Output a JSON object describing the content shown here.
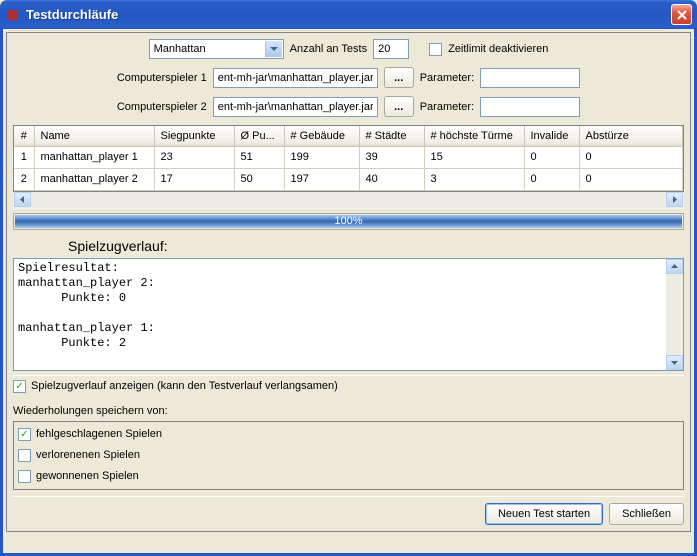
{
  "window": {
    "title": "Testdurchläufe"
  },
  "config": {
    "game": "Manhattan",
    "tests_label": "Anzahl an Tests",
    "tests_value": "20",
    "disable_timelimit_label": "Zeitlimit deaktivieren",
    "player1_label": "Computerspieler 1",
    "player2_label": "Computerspieler 2",
    "player1_path": "ent-mh-jar\\manhattan_player.jar",
    "player2_path": "ent-mh-jar\\manhattan_player.jar",
    "browse_label": "...",
    "param_label": "Parameter:",
    "param1_value": "",
    "param2_value": ""
  },
  "table": {
    "headers": [
      "#",
      "Name",
      "Siegpunkte",
      "Ø Pu...",
      "# Gebäude",
      "# Städte",
      "# höchste Türme",
      "Invalide",
      "Abstürze"
    ],
    "rows": [
      [
        "1",
        "manhattan_player 1",
        "23",
        "51",
        "199",
        "39",
        "15",
        "0",
        "0"
      ],
      [
        "2",
        "manhattan_player 2",
        "17",
        "50",
        "197",
        "40",
        "3",
        "0",
        "0"
      ]
    ]
  },
  "progress": {
    "text": "100%"
  },
  "log": {
    "heading": "Spielzugverlauf:",
    "lines": [
      "Spielresultat:",
      "manhattan_player 2:",
      "      Punkte: 0",
      "",
      "manhattan_player 1:",
      "      Punkte: 2"
    ]
  },
  "show_log_label": "Spielzugverlauf anzeigen (kann den Testverlauf verlangsamen)",
  "replay": {
    "group_label": "Wiederholungen speichern von:",
    "failed_label": "fehlgeschlagenen Spielen",
    "lost_label": "verlorenenen Spielen",
    "won_label": "gewonnenen Spielen"
  },
  "buttons": {
    "new_test": "Neuen Test starten",
    "close": "Schließen"
  }
}
